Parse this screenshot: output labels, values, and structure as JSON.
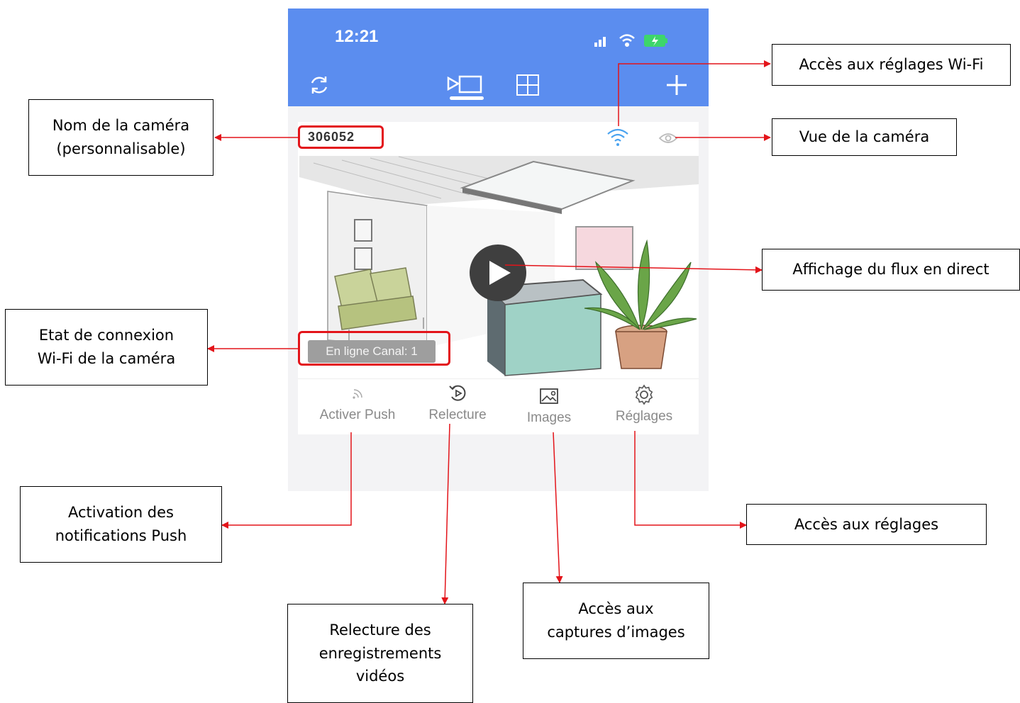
{
  "statusbar": {
    "time": "12:21"
  },
  "camera": {
    "name": "306052",
    "status": "En ligne Canal: 1"
  },
  "actions": [
    {
      "label": "Activer Push",
      "icon": "rss-icon"
    },
    {
      "label": "Relecture",
      "icon": "replay-icon"
    },
    {
      "label": "Images",
      "icon": "image-icon"
    },
    {
      "label": "Réglages",
      "icon": "gear-icon"
    }
  ],
  "callouts": {
    "wifi_settings": "Accès aux réglages Wi-Fi",
    "camera_name_line1": "Nom de la caméra",
    "camera_name_line2": "(personnalisable)",
    "camera_view": "Vue de la caméra",
    "live_stream": "Affichage du flux en direct",
    "connection_line1": "Etat de connexion",
    "connection_line2": "Wi-Fi de la caméra",
    "push_line1": "Activation des",
    "push_line2": "notifications Push",
    "settings": "Accès aux réglages",
    "captures_line1": "Accès aux",
    "captures_line2": "captures d’images",
    "replay_line1": "Relecture des",
    "replay_line2": "enregistrements",
    "replay_line3": "vidéos"
  },
  "colors": {
    "header_blue": "#5b8def",
    "highlight_red": "#e3141a",
    "wifi_blue": "#4aa3f0"
  }
}
